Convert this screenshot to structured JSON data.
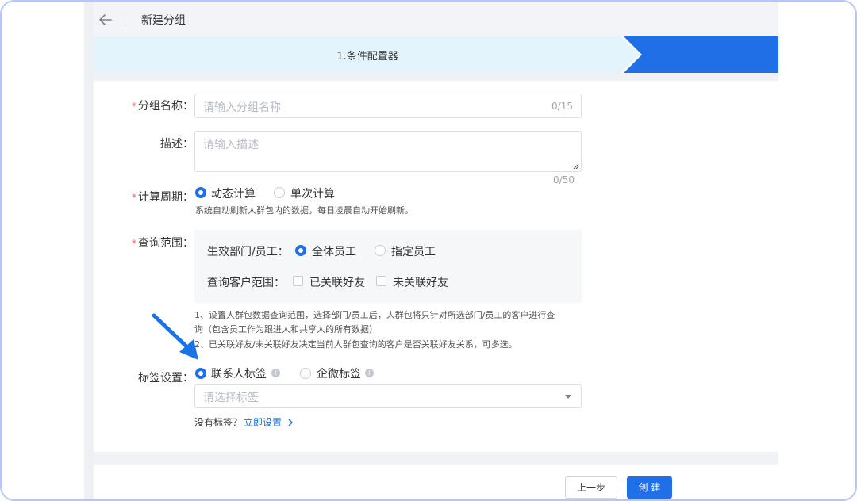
{
  "header": {
    "title": "新建分组",
    "back_icon": "arrow-left-icon"
  },
  "steps": [
    {
      "label": "1.条件配置器",
      "active": false
    },
    {
      "label": "",
      "active": true
    }
  ],
  "form": {
    "group_name": {
      "label": "分组名称：",
      "placeholder": "请输入分组名称",
      "counter": "0/15",
      "required": true
    },
    "description": {
      "label": "描述：",
      "placeholder": "请输入描述",
      "counter": "0/50"
    },
    "calc_period": {
      "label": "计算周期：",
      "required": true,
      "options": [
        {
          "label": "动态计算",
          "selected": true
        },
        {
          "label": "单次计算",
          "selected": false
        }
      ],
      "hint": "系统自动刷新人群包内的数据，每日凌晨自动开始刷新。"
    },
    "query_scope": {
      "label": "查询范围：",
      "required": true,
      "dept_label": "生效部门/员工：",
      "dept_options": [
        {
          "label": "全体员工",
          "selected": true
        },
        {
          "label": "指定员工",
          "selected": false
        }
      ],
      "customer_label": "查询客户范围：",
      "customer_options": [
        {
          "label": "已关联好友",
          "checked": false
        },
        {
          "label": "未关联好友",
          "checked": false
        }
      ],
      "notes": [
        "1、设置人群包数据查询范围，选择部门/员工后，人群包将只针对所选部门/员工的客户进行查",
        "询（包含员工作为跟进人和共享人的所有数据）",
        "2、已关联好友/未关联好友决定当前人群包查询的客户是否关联好友关系，可多选。"
      ]
    },
    "tag_settings": {
      "label": "标签设置：",
      "options": [
        {
          "label": "联系人标签",
          "selected": true
        },
        {
          "label": "企微标签",
          "selected": false
        }
      ],
      "select_placeholder": "请选择标签",
      "no_tag_text": "没有标签？",
      "setup_link": "立即设置"
    }
  },
  "footer": {
    "prev_label": "上一步",
    "create_label": "创 建"
  },
  "colors": {
    "primary": "#1f6fe6",
    "step_bg": "#e3f4fd",
    "annotation": "#1a73e8"
  }
}
